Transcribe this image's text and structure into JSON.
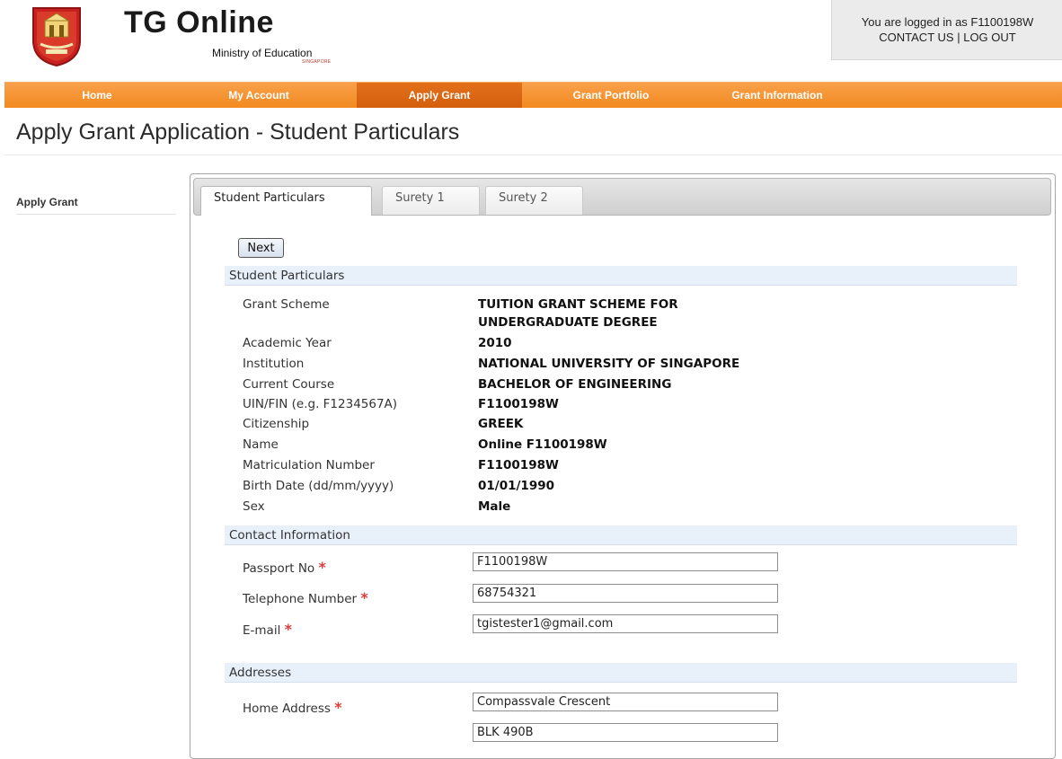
{
  "header": {
    "title": "TG Online",
    "subtitle": "Ministry of Education",
    "subtitle_small": "SINGAPORE",
    "login_text": "You are logged in as F1100198W",
    "contact_us": "CONTACT US",
    "separator": "|",
    "log_out": "LOG OUT",
    "logo_icon": "moe-crest-icon"
  },
  "nav": {
    "items": [
      {
        "label": "Home"
      },
      {
        "label": "My Account"
      },
      {
        "label": "Apply Grant"
      },
      {
        "label": "Grant Portfolio"
      },
      {
        "label": "Grant Information"
      }
    ],
    "active": "Apply Grant",
    "color": "#f28a1f",
    "active_color": "#d8620f"
  },
  "page": {
    "title": "Apply Grant Application - Student Particulars"
  },
  "sidebar": {
    "items": [
      {
        "label": "Apply Grant"
      }
    ]
  },
  "tabs": [
    {
      "label": "Student Particulars"
    },
    {
      "label": "Surety 1"
    },
    {
      "label": "Surety 2"
    }
  ],
  "form": {
    "next_label": "Next",
    "required_marker": "*",
    "student": {
      "heading": "Student Particulars",
      "rows": [
        {
          "label": "Grant Scheme",
          "value": "TUITION GRANT SCHEME FOR",
          "value2": "UNDERGRADUATE DEGREE"
        },
        {
          "label": "Academic Year",
          "value": "2010"
        },
        {
          "label": "Institution",
          "value": "NATIONAL UNIVERSITY OF SINGAPORE"
        },
        {
          "label": "Current Course",
          "value": "BACHELOR OF ENGINEERING"
        },
        {
          "label": "UIN/FIN (e.g. F1234567A)",
          "value": "F1100198W"
        },
        {
          "label": "Citizenship",
          "value": "GREEK"
        },
        {
          "label": "Name",
          "value": "Online F1100198W"
        },
        {
          "label": "Matriculation Number",
          "value": "F1100198W"
        },
        {
          "label": "Birth Date (dd/mm/yyyy)",
          "value": "01/01/1990"
        },
        {
          "label": "Sex",
          "value": "Male"
        }
      ]
    },
    "contact": {
      "heading": "Contact Information",
      "fields": [
        {
          "label": "Passport No",
          "value": "F1100198W"
        },
        {
          "label": "Telephone Number",
          "value": "68754321"
        },
        {
          "label": "E-mail",
          "value": "tgistester1@gmail.com"
        }
      ]
    },
    "addresses": {
      "heading": "Addresses",
      "home_label": "Home Address",
      "lines": [
        "Compassvale Crescent",
        "BLK 490B"
      ]
    }
  }
}
